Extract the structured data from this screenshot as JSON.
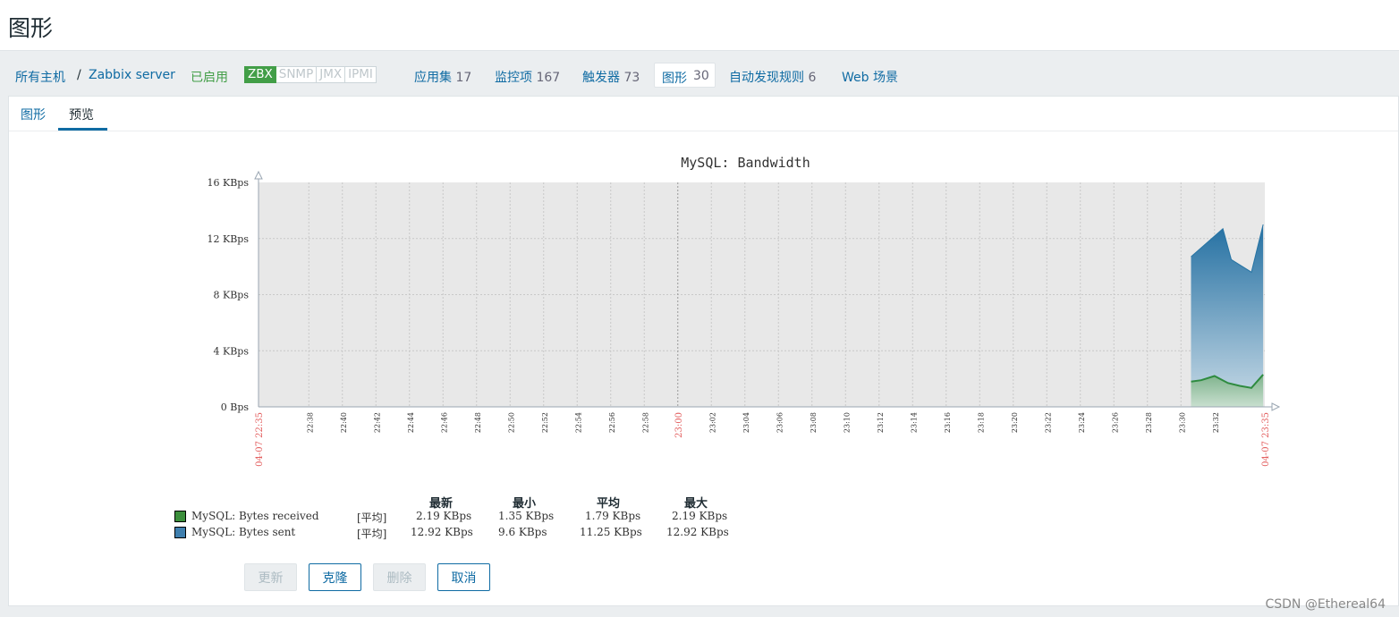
{
  "page": {
    "title": "图形"
  },
  "breadcrumb": {
    "all_hosts": "所有主机",
    "separator": "/",
    "host": "Zabbix server",
    "status": "已启用"
  },
  "badges": [
    "ZBX",
    "SNMP",
    "JMX",
    "IPMI"
  ],
  "nav": [
    {
      "label": "应用集",
      "count": "17"
    },
    {
      "label": "监控项",
      "count": "167"
    },
    {
      "label": "触发器",
      "count": "73"
    },
    {
      "label": "图形",
      "count": "30"
    },
    {
      "label": "自动发现规则",
      "count": "6"
    },
    {
      "label": "Web 场景",
      "count": ""
    }
  ],
  "tabs": [
    "图形",
    "预览"
  ],
  "chart_data": {
    "type": "area",
    "title": "MySQL: Bandwidth",
    "y_ticks": [
      "16 KBps",
      "12 KBps",
      "8 KBps",
      "4 KBps",
      "0 Bps"
    ],
    "ylim": [
      0,
      16
    ],
    "x_ticks": [
      "22:38",
      "22:40",
      "22:42",
      "22:44",
      "22:46",
      "22:48",
      "22:50",
      "22:52",
      "22:54",
      "22:56",
      "22:58",
      "23:00",
      "23:02",
      "23:04",
      "23:06",
      "23:08",
      "23:10",
      "23:12",
      "23:14",
      "23:16",
      "23:18",
      "23:20",
      "23:22",
      "23:24",
      "23:26",
      "23:28",
      "23:30",
      "23:32"
    ],
    "x_start_label": "04-07 22:35",
    "x_end_label": "04-07 23:35",
    "grid": true,
    "series": [
      {
        "name": "MySQL: Bytes sent",
        "color": "#2774a4",
        "times_min": [
          55.6,
          57.5,
          58.0,
          59.2,
          59.9
        ],
        "x_time": [
          "23:30:36",
          "23:32:30",
          "23:33:00",
          "23:34:12",
          "23:34:54"
        ],
        "values": [
          10.7,
          12.7,
          10.5,
          9.6,
          13.0
        ]
      },
      {
        "name": "MySQL: Bytes received",
        "color": "#2e8b3f",
        "times_min": [
          55.6,
          56.2,
          57.0,
          57.8,
          58.5,
          59.2,
          59.9
        ],
        "x_time": [
          "23:30:36",
          "23:31:12",
          "23:32:00",
          "23:32:48",
          "23:33:30",
          "23:34:12",
          "23:34:54"
        ],
        "values": [
          1.8,
          1.9,
          2.2,
          1.7,
          1.5,
          1.35,
          2.3
        ]
      }
    ],
    "legend": {
      "headers": [
        "最新",
        "最小",
        "平均",
        "最大"
      ],
      "rows": [
        {
          "name": "MySQL: Bytes received",
          "func": "[平均]",
          "last": "2.19 KBps",
          "min": "1.35 KBps",
          "avg": "1.79 KBps",
          "max": "2.19 KBps",
          "color": "#3b8e3b"
        },
        {
          "name": "MySQL: Bytes sent",
          "func": "[平均]",
          "last": "12.92 KBps",
          "min": "9.6 KBps",
          "avg": "11.25 KBps",
          "max": "12.92 KBps",
          "color": "#3f7fae"
        }
      ]
    }
  },
  "buttons": {
    "update": "更新",
    "clone": "克隆",
    "delete": "删除",
    "cancel": "取消"
  },
  "watermark": "CSDN @Ethereal64"
}
